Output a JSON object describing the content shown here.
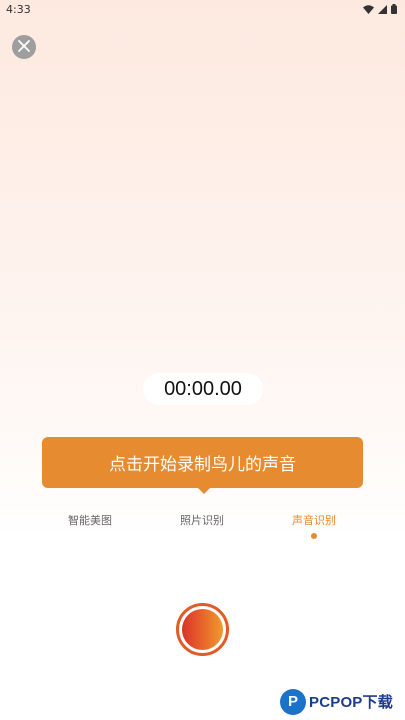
{
  "status_bar": {
    "time": "4:33",
    "icons": [
      "wifi-icon",
      "signal-icon",
      "battery-icon"
    ]
  },
  "close_icon": "close-icon",
  "timer": {
    "value": "00:00.00"
  },
  "prompt": {
    "text": "点击开始录制鸟儿的声音"
  },
  "tabs": [
    {
      "label": "智能美图",
      "active": false
    },
    {
      "label": "照片识别",
      "active": false
    },
    {
      "label": "声音识别",
      "active": true
    }
  ],
  "record_button": {
    "icon": "record-icon"
  },
  "watermark": {
    "logo_letter": "P",
    "text": "PCPOP下载"
  },
  "colors": {
    "accent": "#e68b2f",
    "record_gradient_start": "#d9342a",
    "record_gradient_end": "#f09a2e",
    "close_bg": "#9e9e9e"
  }
}
